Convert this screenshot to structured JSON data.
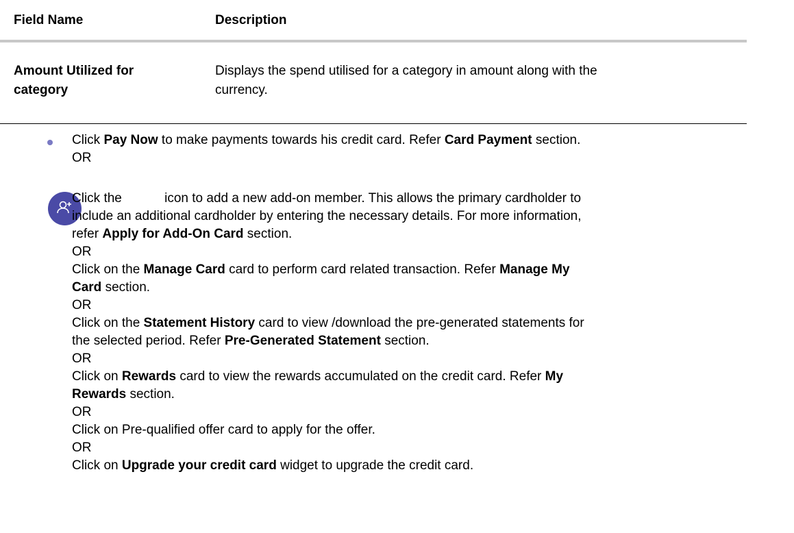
{
  "table": {
    "headers": {
      "field": "Field Name",
      "description": "Description"
    },
    "rows": [
      {
        "field_line1": "Amount Utilized for",
        "field_line2": "category",
        "desc_line1": "Displays the spend utilised for a category in amount along with the",
        "desc_line2": "currency."
      }
    ]
  },
  "content": {
    "p1": {
      "a": "Click ",
      "b": "Pay Now",
      "c": " to make payments towards his credit card. Refer ",
      "d": "Card Payment",
      "e": " section."
    },
    "or": "OR",
    "p2": {
      "a": "Click the ",
      "b": "icon to add a new add-on member. This allows the primary cardholder to",
      "line2": "include an additional cardholder by entering the necessary details. For more information,",
      "line3a": "refer ",
      "line3b": "Apply for Add-On Card",
      "line3c": " section."
    },
    "p3": {
      "a": "Click on the ",
      "b": "Manage Card",
      "c": " card to perform card related transaction. Refer ",
      "d": "Manage My",
      "line2a": "Card",
      "line2b": " section."
    },
    "p4": {
      "a": "Click on the ",
      "b": "Statement History",
      "c": " card to view /download the pre-generated statements for",
      "line2a": "the selected period. Refer ",
      "line2b": "Pre-Generated Statement",
      "line2c": " section."
    },
    "p5": {
      "a": "Click on ",
      "b": "Rewards",
      "c": " card to view the rewards accumulated on the credit card. Refer ",
      "d": "My",
      "line2a": "Rewards",
      "line2b": " section."
    },
    "p6": "Click on Pre-qualified offer card to apply for the offer.",
    "p7": {
      "a": "Click on ",
      "b": "Upgrade your credit card",
      "c": " widget to upgrade the credit card."
    }
  },
  "icons": {
    "addon": "add-user-icon",
    "bullet": "bullet-icon"
  },
  "colors": {
    "icon_bg": "#4a4aa6",
    "bullet": "#7a7ac4",
    "rule": "#c8c8c8"
  }
}
